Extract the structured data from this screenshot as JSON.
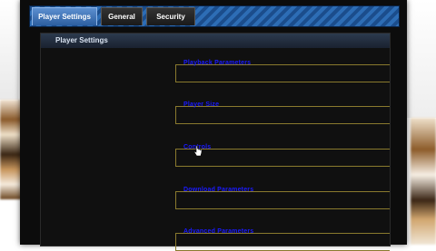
{
  "tabs": [
    {
      "label": "Player Settings",
      "active": true
    },
    {
      "label": "General",
      "active": false
    },
    {
      "label": "Security",
      "active": false
    }
  ],
  "panel": {
    "title": "Player Settings"
  },
  "groups": [
    {
      "label": "Playback Parameters"
    },
    {
      "label": "Player Size"
    },
    {
      "label": "Controls"
    },
    {
      "label": "Download Parameters"
    },
    {
      "label": "Advanced Parameters"
    }
  ],
  "colors": {
    "tab_accent": "#2d6db5",
    "group_border": "#8a7a2e",
    "group_label": "#1a1aff",
    "window_bg": "#0c0c0c"
  }
}
